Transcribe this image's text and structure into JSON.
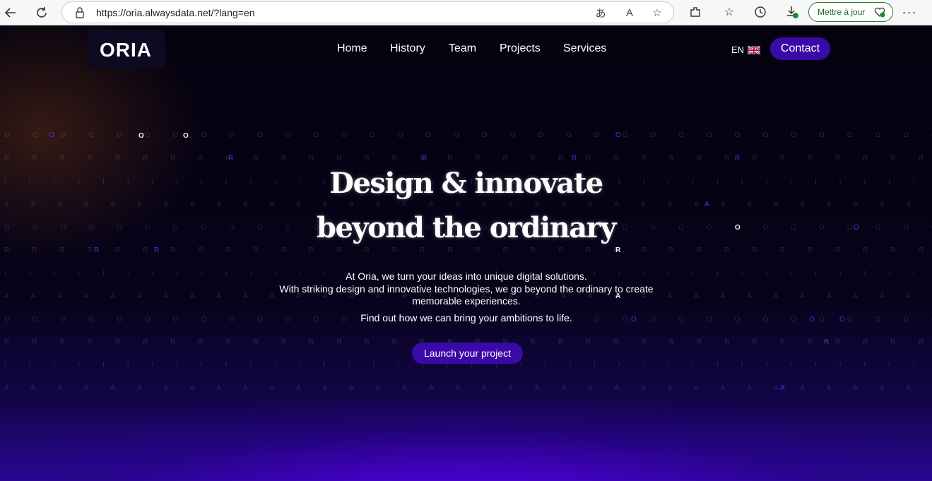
{
  "browser": {
    "url": "https://oria.alwaysdata.net/?lang=en",
    "update_label": "Mettre à jour"
  },
  "site": {
    "logo": "ORIA",
    "nav": {
      "home": "Home",
      "history": "History",
      "team": "Team",
      "projects": "Projects",
      "services": "Services"
    },
    "language": "EN",
    "contact": "Contact"
  },
  "hero": {
    "title_line1": "Design & innovate",
    "title_line2": "beyond the ordinary",
    "text_line1": "At Oria, we turn your ideas into unique digital solutions.",
    "text_line2": "With striking design and innovative technologies, we go beyond the ordinary to create memorable experiences.",
    "text_line3": "Find out how we can bring your ambitions to life.",
    "cta": "Launch your project"
  },
  "background": {
    "row_o": "O O O O O O O O O O O O O O O O O O O O O O O O O O O O O O O O O O O O O O O O O O O O O O O O O O O O O O O O O O O O O O O O O O O O O O O O O O O O O O O O O O O O",
    "row_r": "R R R R R R R R R R R R R R R R R R R R R R R R R R R R R R R R R R R R R R R R R R R R R R R R R R R R R R R R R R R R R R R R R R R R R R R R R R R R R R R R R R R R",
    "row_i": "I I I I I I I I I I I I I I I I I I I I I I I I I I I I I I I I I I I I I I I I I I I I I I I I I I I I I I I I I I I I I I I I I I I I I I I I I I I I I I I I I I I I",
    "row_a": "A A A A A A A A A A A A A A A A A A A A A A A A A A A A A A A A A A A A A A A A A A A A A A A A A A A A A A A A A A A A A A A A A A A A A A A A A A A A A A A A A A A A",
    "glow_o": "O",
    "glow_r": "R",
    "glow_a": "A"
  },
  "colors": {
    "accent": "#3a0aa8",
    "background": "#05020f",
    "glow": "#2a0794"
  }
}
